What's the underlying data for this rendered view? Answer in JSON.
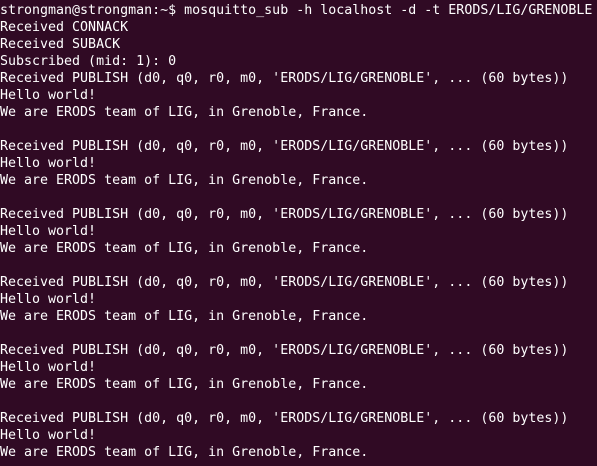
{
  "terminal": {
    "background": "#300a24",
    "foreground": "#ffffff",
    "lines": [
      "strongman@strongman:~$ mosquitto_sub -h localhost -d -t ERODS/LIG/GRENOBLE",
      "Received CONNACK",
      "Received SUBACK",
      "Subscribed (mid: 1): 0",
      "Received PUBLISH (d0, q0, r0, m0, 'ERODS/LIG/GRENOBLE', ... (60 bytes))",
      "Hello world!",
      "We are ERODS team of LIG, in Grenoble, France.",
      "",
      "Received PUBLISH (d0, q0, r0, m0, 'ERODS/LIG/GRENOBLE', ... (60 bytes))",
      "Hello world!",
      "We are ERODS team of LIG, in Grenoble, France.",
      "",
      "Received PUBLISH (d0, q0, r0, m0, 'ERODS/LIG/GRENOBLE', ... (60 bytes))",
      "Hello world!",
      "We are ERODS team of LIG, in Grenoble, France.",
      "",
      "Received PUBLISH (d0, q0, r0, m0, 'ERODS/LIG/GRENOBLE', ... (60 bytes))",
      "Hello world!",
      "We are ERODS team of LIG, in Grenoble, France.",
      "",
      "Received PUBLISH (d0, q0, r0, m0, 'ERODS/LIG/GRENOBLE', ... (60 bytes))",
      "Hello world!",
      "We are ERODS team of LIG, in Grenoble, France.",
      "",
      "Received PUBLISH (d0, q0, r0, m0, 'ERODS/LIG/GRENOBLE', ... (60 bytes))",
      "Hello world!",
      "We are ERODS team of LIG, in Grenoble, France."
    ]
  }
}
